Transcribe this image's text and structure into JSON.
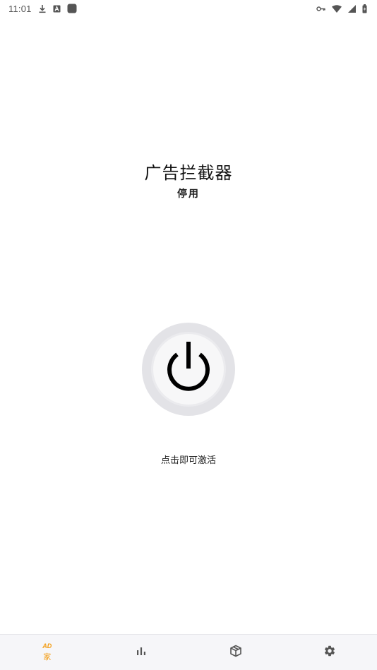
{
  "status_bar": {
    "time": "11:01",
    "left_icons": [
      "download-icon",
      "font-a-icon",
      "app-square-icon"
    ],
    "right_icons": [
      "vpn-key-icon",
      "wifi-icon",
      "signal-icon",
      "battery-icon"
    ]
  },
  "header": {
    "title": "广告拦截器",
    "status": "停用"
  },
  "power": {
    "icon": "power-icon",
    "hint": "点击即可激活"
  },
  "bottom_nav": {
    "items": [
      {
        "icon": "ad-icon",
        "icon_text": "AD",
        "label": "家",
        "active": true
      },
      {
        "icon": "bar-chart-icon",
        "label": ""
      },
      {
        "icon": "box-icon",
        "label": ""
      },
      {
        "icon": "gear-icon",
        "label": ""
      }
    ]
  },
  "colors": {
    "accent": "#f39c12",
    "nav_bg": "#f6f6f9",
    "power_ring": "#e3e3e7"
  }
}
